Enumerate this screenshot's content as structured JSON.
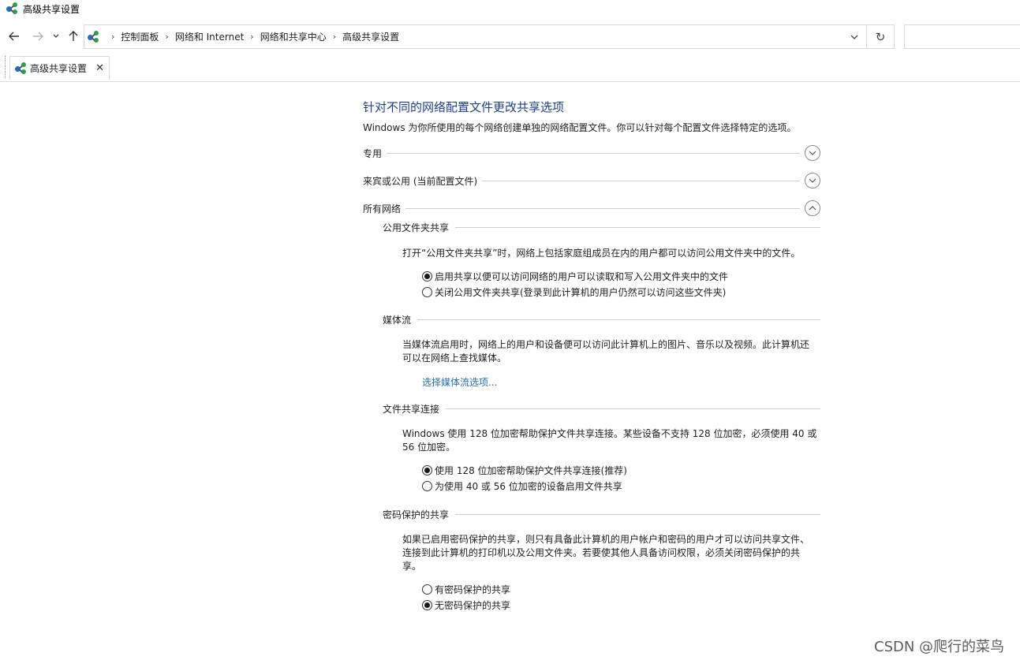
{
  "window": {
    "title": "高级共享设置"
  },
  "nav": {
    "back_icon": "arrow-left-icon",
    "forward_icon": "arrow-right-icon",
    "recent_icon": "chevron-down-icon",
    "up_icon": "arrow-up-icon",
    "breadcrumbs": [
      "控制面板",
      "网络和 Internet",
      "网络和共享中心",
      "高级共享设置"
    ],
    "search_placeholder": ""
  },
  "tab": {
    "label": "高级共享设置"
  },
  "page": {
    "heading": "针对不同的网络配置文件更改共享选项",
    "intro": "Windows 为你所使用的每个网络创建单独的网络配置文件。你可以针对每个配置文件选择特定的选项。"
  },
  "profiles": [
    {
      "label": "专用",
      "expanded": false
    },
    {
      "label": "来宾或公用 (当前配置文件)",
      "expanded": false
    },
    {
      "label": "所有网络",
      "expanded": true
    }
  ],
  "sections": {
    "public_folder": {
      "title": "公用文件夹共享",
      "desc": "打开“公用文件夹共享”时，网络上包括家庭组成员在内的用户都可以访问公用文件夹中的文件。",
      "options": [
        {
          "label": "启用共享以便可以访问网络的用户可以读取和写入公用文件夹中的文件",
          "selected": true
        },
        {
          "label": "关闭公用文件夹共享(登录到此计算机的用户仍然可以访问这些文件夹)",
          "selected": false
        }
      ]
    },
    "media": {
      "title": "媒体流",
      "desc_line1": "当媒体流启用时，网络上的用户和设备便可以访问此计算机上的图片、音乐以及视频。此计算机还",
      "desc_line2": "可以在网络上查找媒体。",
      "link": "选择媒体流选项..."
    },
    "file_sharing": {
      "title": "文件共享连接",
      "desc_line1": "Windows 使用 128 位加密帮助保护文件共享连接。某些设备不支持 128 位加密，必须使用 40 或",
      "desc_line2": "56 位加密。",
      "options": [
        {
          "label": "使用 128 位加密帮助保护文件共享连接(推荐)",
          "selected": true
        },
        {
          "label": "为使用 40 或 56 位加密的设备启用文件共享",
          "selected": false
        }
      ]
    },
    "password": {
      "title": "密码保护的共享",
      "desc_line1": "如果已启用密码保护的共享，则只有具备此计算机的用户帐户和密码的用户才可以访问共享文件、",
      "desc_line2": "连接到此计算机的打印机以及公用文件夹。若要使其他人具备访问权限，必须关闭密码保护的共",
      "desc_line3": "享。",
      "options": [
        {
          "label": "有密码保护的共享",
          "selected": false
        },
        {
          "label": "无密码保护的共享",
          "selected": true
        }
      ]
    }
  },
  "watermark": "CSDN @爬行的菜鸟"
}
